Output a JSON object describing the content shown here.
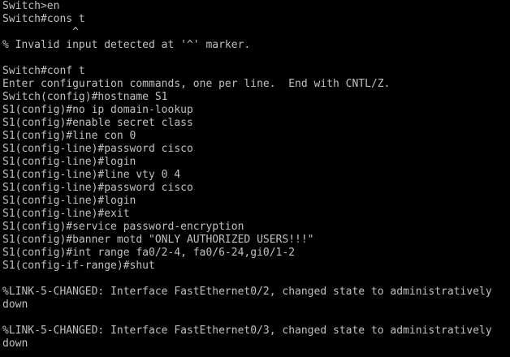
{
  "terminal": {
    "lines": [
      "Switch>en",
      "Switch#cons t",
      "           ^",
      "% Invalid input detected at '^' marker.",
      "",
      "Switch#conf t",
      "Enter configuration commands, one per line.  End with CNTL/Z.",
      "Switch(config)#hostname S1",
      "S1(config)#no ip domain-lookup",
      "S1(config)#enable secret class",
      "S1(config)#line con 0",
      "S1(config-line)#password cisco",
      "S1(config-line)#login",
      "S1(config-line)#line vty 0 4",
      "S1(config-line)#password cisco",
      "S1(config-line)#login",
      "S1(config-line)#exit",
      "S1(config)#service password-encryption",
      "S1(config)#banner motd \"ONLY AUTHORIZED USERS!!!\"",
      "S1(config)#int range fa0/2-4, fa0/6-24,gi0/1-2",
      "S1(config-if-range)#shut",
      "",
      "%LINK-5-CHANGED: Interface FastEthernet0/2, changed state to administratively",
      "down",
      "",
      "%LINK-5-CHANGED: Interface FastEthernet0/3, changed state to administratively",
      "down"
    ]
  }
}
